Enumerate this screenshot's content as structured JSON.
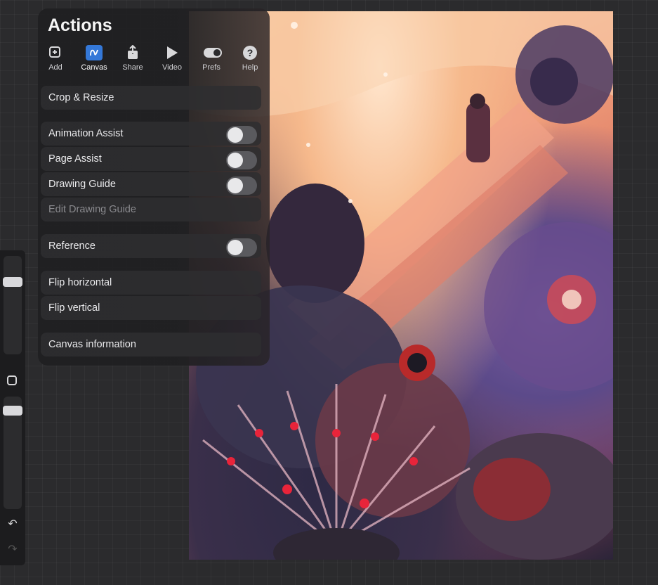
{
  "panel": {
    "title": "Actions",
    "tabs": [
      {
        "label": "Add",
        "icon": "add-image-icon"
      },
      {
        "label": "Canvas",
        "icon": "canvas-wave-icon",
        "active": true
      },
      {
        "label": "Share",
        "icon": "share-icon"
      },
      {
        "label": "Video",
        "icon": "play-icon"
      },
      {
        "label": "Prefs",
        "icon": "toggle-icon"
      },
      {
        "label": "Help",
        "icon": "question-icon"
      }
    ],
    "items": {
      "crop_resize": "Crop & Resize",
      "animation_assist": "Animation Assist",
      "page_assist": "Page Assist",
      "drawing_guide": "Drawing Guide",
      "edit_drawing_guide": "Edit Drawing Guide",
      "reference": "Reference",
      "flip_horizontal": "Flip horizontal",
      "flip_vertical": "Flip vertical",
      "canvas_information": "Canvas information"
    },
    "toggles": {
      "animation_assist": false,
      "page_assist": false,
      "drawing_guide": false,
      "reference": false
    }
  },
  "sidebar": {
    "undo_icon": "undo-icon",
    "redo_icon": "redo-icon",
    "modify_icon": "square-icon"
  },
  "colors": {
    "accent": "#3478d8",
    "panel_bg": "#202022",
    "toggle_off": "#5a5a5e"
  }
}
